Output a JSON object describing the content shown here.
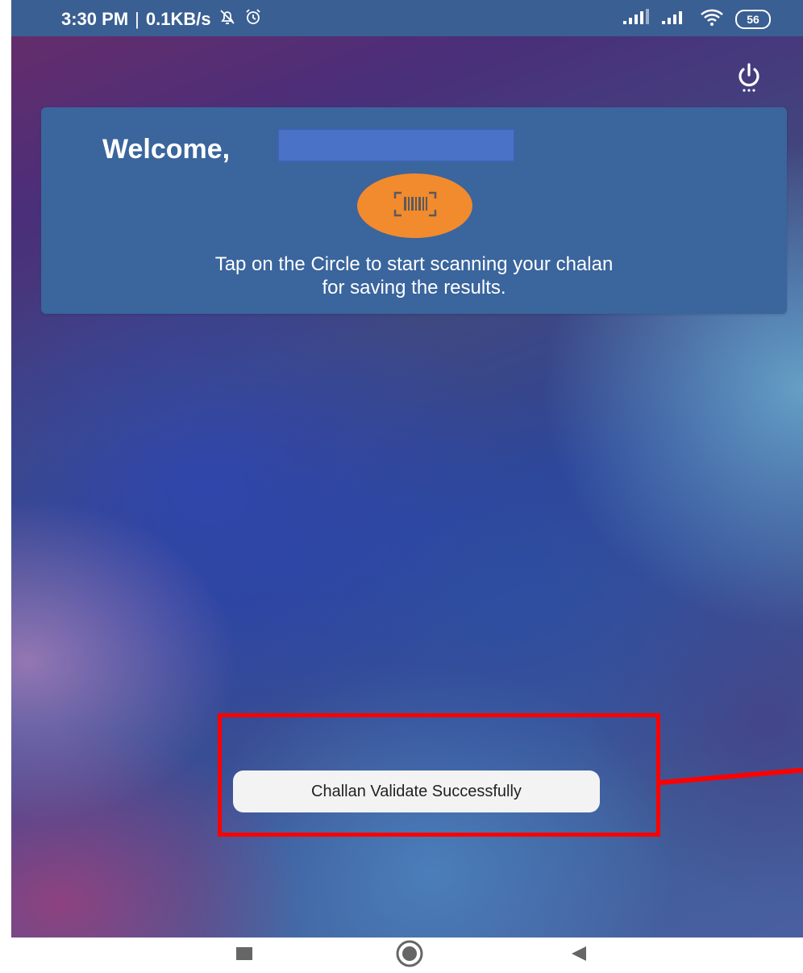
{
  "status_bar": {
    "time": "3:30 PM",
    "separator": "|",
    "network_speed": "0.1KB/s",
    "battery_level": "56",
    "icons": [
      "silent-bell-icon",
      "alarm-clock-icon",
      "signal-icon",
      "signal-icon",
      "wifi-icon",
      "battery-icon"
    ]
  },
  "header": {
    "power_icon": "power-icon"
  },
  "welcome_card": {
    "greeting": "Welcome,",
    "scan_icon": "barcode-scan-icon",
    "instruction_line1": "Tap on the Circle to start scanning your chalan",
    "instruction_line2": "for saving the results."
  },
  "toast": {
    "message": "Challan Validate Successfully"
  },
  "nav_bar": {
    "buttons": [
      "recents-square-icon",
      "home-circle-icon",
      "back-triangle-icon"
    ]
  },
  "colors": {
    "status_bar": "#3a5f92",
    "card": "#3a659d",
    "scan_button": "#f28a2e",
    "name_box": "#4a73c8",
    "highlight": "#ff0000",
    "toast_bg": "#f3f3f3"
  }
}
